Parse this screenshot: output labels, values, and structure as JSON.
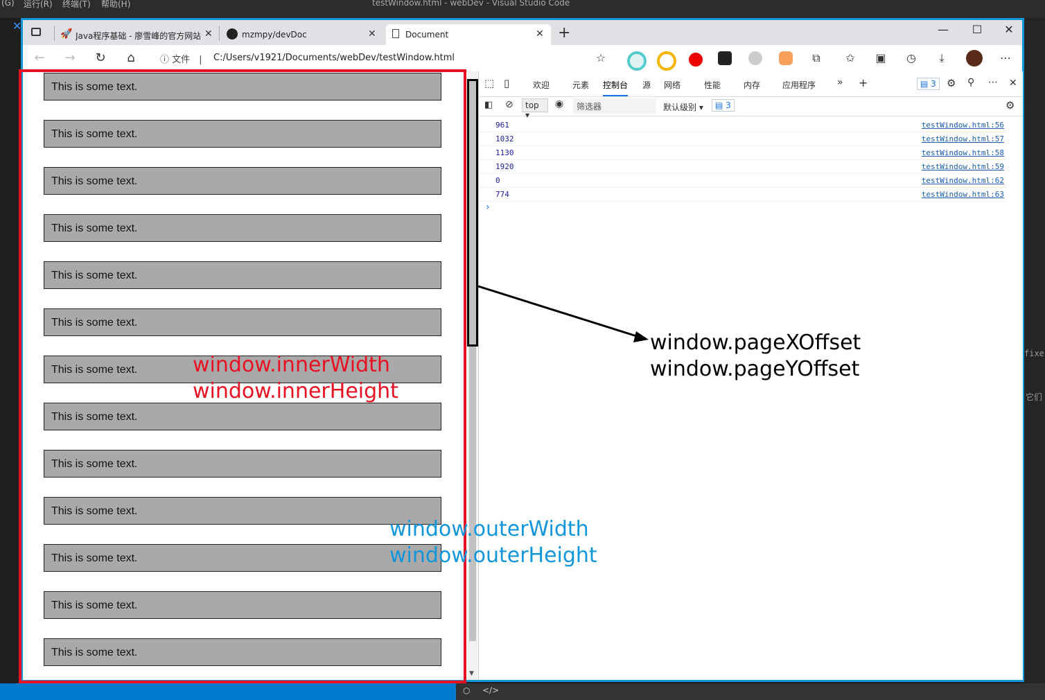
{
  "vscode": {
    "menu": [
      "(G)",
      "运行(R)",
      "终端(T)",
      "帮助(H)"
    ],
    "title": "testWindow.html - webDev - Visual Studio Code",
    "right_fragments": [
      "fixe",
      "它们"
    ]
  },
  "tabs": [
    {
      "title": "Java程序基础 - 廖雪峰的官方网站",
      "icon": "rocket-icon"
    },
    {
      "title": "mzmpy/devDoc",
      "icon": "github-icon"
    },
    {
      "title": "Document",
      "icon": "document-icon",
      "active": true
    }
  ],
  "address": {
    "info_label": "文件",
    "url": "C:/Users/v1921/Documents/webDev/testWindow.html"
  },
  "page": {
    "boxes": [
      "This is some text.",
      "This is some text.",
      "This is some text.",
      "This is some text.",
      "This is some text.",
      "This is some text.",
      "This is some text.",
      "This is some text.",
      "This is some text.",
      "This is some text.",
      "This is some text.",
      "This is some text.",
      "This is some text."
    ]
  },
  "devtools": {
    "tabs": [
      "欢迎",
      "元素",
      "控制台",
      "源",
      "网络",
      "性能",
      "内存",
      "应用程序"
    ],
    "active_tab": "控制台",
    "issues_count": "3",
    "context": "top",
    "filter_placeholder": "筛选器",
    "level": "默认级别",
    "logs": [
      {
        "value": "961",
        "source": "testWindow.html:56"
      },
      {
        "value": "1032",
        "source": "testWindow.html:57"
      },
      {
        "value": "1130",
        "source": "testWindow.html:58"
      },
      {
        "value": "1920",
        "source": "testWindow.html:59"
      },
      {
        "value": "0",
        "source": "testWindow.html:62"
      },
      {
        "value": "774",
        "source": "testWindow.html:63"
      }
    ],
    "prompt": "›"
  },
  "annotations": {
    "inner": [
      "window.innerWidth",
      "window.innerHeight"
    ],
    "outer": [
      "window.outerWidth",
      "window.outerHeight"
    ],
    "offset": [
      "window.pageXOffset",
      "window.pageYOffset"
    ],
    "colors": {
      "inner": "#e81123",
      "outer": "#1296db",
      "offset": "#000000"
    }
  }
}
